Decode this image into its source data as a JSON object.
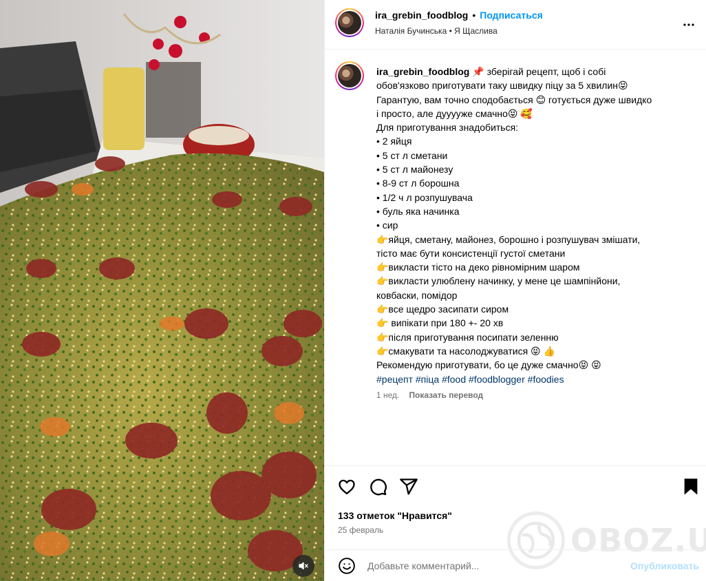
{
  "post": {
    "username": "ira_grebin_foodblog",
    "separator": "•",
    "follow_label": "Подписаться",
    "audio": "Наталія Бучинська • Я Щаслива",
    "more_icon": "more-horizontal-icon"
  },
  "caption": {
    "username": "ira_grebin_foodblog",
    "lines": [
      "📌 зберігай рецепт, щоб і собі",
      "обов'язково приготувати таку швидку піцу за 5 хвилин😝",
      "Гарантую, вам точно сподобається 😊 готується дуже швидко",
      "і просто, але дууууже смачно😝 🥰",
      "Для приготування знадобиться:",
      "• 2 яйця",
      "• 5 ст л сметани",
      "• 5 ст л майонезу",
      "• 8-9 ст л борошна",
      "• 1/2 ч л розпушувача",
      "• буль яка начинка",
      "• сир",
      "👉яйця, сметану, майонез, борошно і розпушувач змішати,",
      "тісто має бути консистенції густої сметани",
      "👉викласти тісто на деко рівномірним шаром",
      "👉викласти улюблену начинку, у мене це шампінйони,",
      "ковбаски, помідор",
      "👉все щедро засипати сиром",
      "👉 випікати при 180 +- 20 хв",
      "👉після приготування посипати зеленню",
      "👉смакувати та насолоджуватися 😝 👍",
      "Рекомендую приготувати, бо це дуже смачно😝 😝"
    ],
    "hashtags": [
      "#рецепт",
      "#піца",
      "#food",
      "#foodblogger",
      "#foodies"
    ],
    "time_ago": "1 нед.",
    "translate_label": "Показать перевод"
  },
  "actions": {
    "icons": [
      "heart-icon",
      "comment-icon",
      "share-icon",
      "bookmark-icon"
    ],
    "likes": "133 отметок \"Нравится\"",
    "date": "25 февраль"
  },
  "watermark": {
    "text": "OBOZ.UA"
  },
  "comment": {
    "placeholder": "Добавьте комментарий...",
    "publish_label": "Опубликовать",
    "emoji_icon": "smiley-icon"
  },
  "media": {
    "mute_icon": "speaker-muted-icon"
  }
}
